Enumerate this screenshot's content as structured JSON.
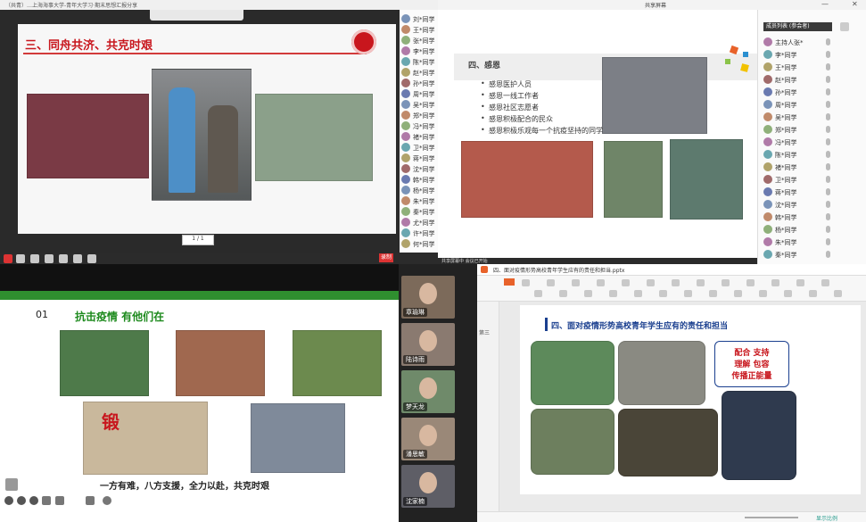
{
  "q1": {
    "window_title": "（共青）…上海海事大学-青年大学习·期末思想汇报分享",
    "slide_title": "三、同舟共济、共克时艰",
    "page_indicator": "1 / 1",
    "record_label": "录制",
    "participants": [
      "刘*同学",
      "王*同学",
      "张*同学",
      "李*同学",
      "陈*同学",
      "赵*同学",
      "孙*同学",
      "周*同学",
      "吴*同学",
      "郑*同学",
      "冯*同学",
      "褚*同学",
      "卫*同学",
      "蒋*同学",
      "沈*同学",
      "韩*同学",
      "杨*同学",
      "朱*同学",
      "秦*同学",
      "尤*同学",
      "许*同学",
      "何*同学"
    ]
  },
  "q2": {
    "window_title": "共享屏幕",
    "slide_title": "四、感恩",
    "bullets": [
      "感恩医护人员",
      "感恩一线工作者",
      "感恩社区志愿者",
      "感恩积极配合的民众",
      "感恩积极乐观每一个抗疫坚持的同学"
    ],
    "status_label": "共享屏幕中  会议已开始",
    "panel_title": "成员列表  (参会者)",
    "participants": [
      "主持人张*",
      "李*同学",
      "王*同学",
      "赵*同学",
      "孙*同学",
      "周*同学",
      "吴*同学",
      "郑*同学",
      "冯*同学",
      "陈*同学",
      "褚*同学",
      "卫*同学",
      "蒋*同学",
      "沈*同学",
      "韩*同学",
      "杨*同学",
      "朱*同学",
      "秦*同学"
    ]
  },
  "q3": {
    "slide_number": "01",
    "slide_title": "抗击疫情 有他们在",
    "slide_caption": "一方有难，八方支援，全力以赴，共克时艰",
    "photo_sign": "锻",
    "video_names": [
      "章瑜琳",
      "陆诗雨",
      "梦天龙",
      "潘思敏",
      "沈家楠"
    ]
  },
  "q4": {
    "tab_label": "四、面对疫情形势高校青年学生应有的责任和担当.pptx",
    "slide_title": "四、面对疫情形势高校青年学生应有的责任和担当",
    "callout_line1": "配合  支持",
    "callout_line2": "理解  包容",
    "callout_line3": "传播正能量",
    "side_label": "第三",
    "zoom_label": "显示比例"
  },
  "colors": {
    "q1_title_red": "#c8161d",
    "q3_green": "#2f8f2f",
    "q3_title_green": "#1d8a1d",
    "q4_title_blue": "#1a3f8f",
    "wps_orange": "#e8622a"
  }
}
